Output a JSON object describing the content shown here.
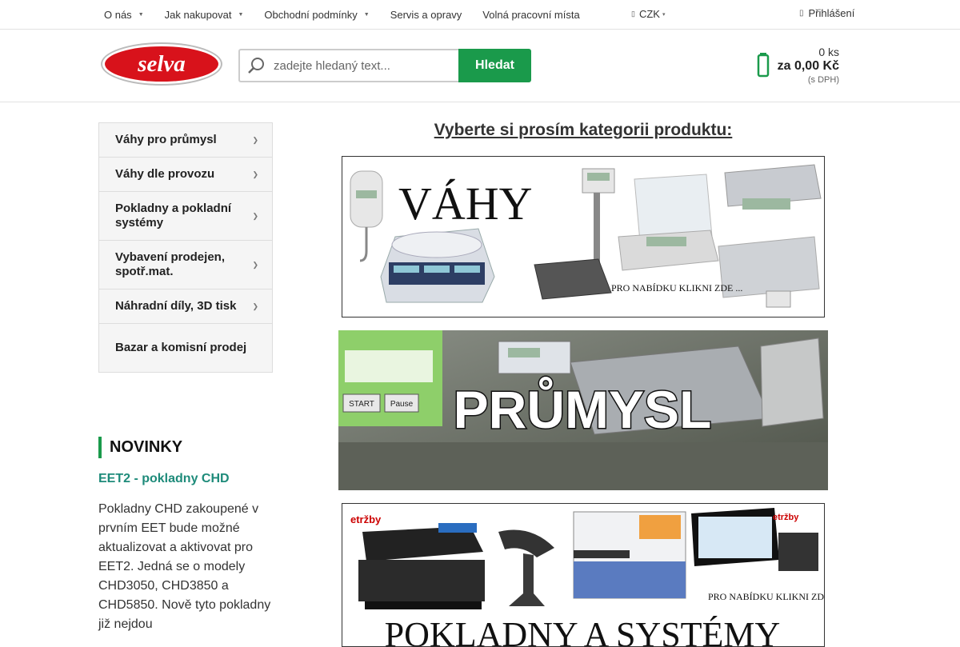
{
  "topbar": {
    "nav": [
      {
        "label": "O nás",
        "dropdown": true
      },
      {
        "label": "Jak nakupovat",
        "dropdown": true
      },
      {
        "label": "Obchodní podmínky",
        "dropdown": true
      },
      {
        "label": "Servis a opravy",
        "dropdown": false
      },
      {
        "label": "Volná pracovní místa",
        "dropdown": false
      }
    ],
    "currency": "CZK",
    "login": "Přihlášení"
  },
  "header": {
    "logo_text": "selva",
    "search_placeholder": "zadejte hledaný text...",
    "search_button": "Hledat",
    "cart": {
      "count": "0 ks",
      "total": "za 0,00 Kč",
      "vat_note": "(s DPH)"
    }
  },
  "sidebar": {
    "categories": [
      "Váhy pro průmysl",
      "Váhy dle provozu",
      "Pokladny a pokladní systémy",
      "Vybavení prodejen, spotř.mat.",
      "Náhradní díly, 3D tisk",
      "Bazar a komisní prodej"
    ]
  },
  "news": {
    "heading": "NOVINKY",
    "title": "EET2 - pokladny CHD",
    "body": "Pokladny CHD zakoupené v prvním EET bude možné aktualizovat a aktivovat pro EET2. Jedná se o modely CHD3050, CHD3850 a CHD5850. Nově tyto pokladny již nejdou"
  },
  "main": {
    "title": "Vyberte si prosím kategorii produktu:",
    "banners": [
      {
        "title": "VÁHY",
        "cta": "PRO NABÍDKU KLIKNI ZDE ..."
      },
      {
        "title": "PRŮMYSL",
        "screen_start": "START",
        "screen_pause": "Pause"
      },
      {
        "title": "POKLADNY A SYSTÉMY",
        "cta": "PRO NABÍDKU KLIKNI ZDE ...",
        "brand": "etržby"
      }
    ]
  },
  "colors": {
    "accent": "#1a9a4b",
    "news_link": "#1e8b7a",
    "logo_red": "#d8121b"
  }
}
